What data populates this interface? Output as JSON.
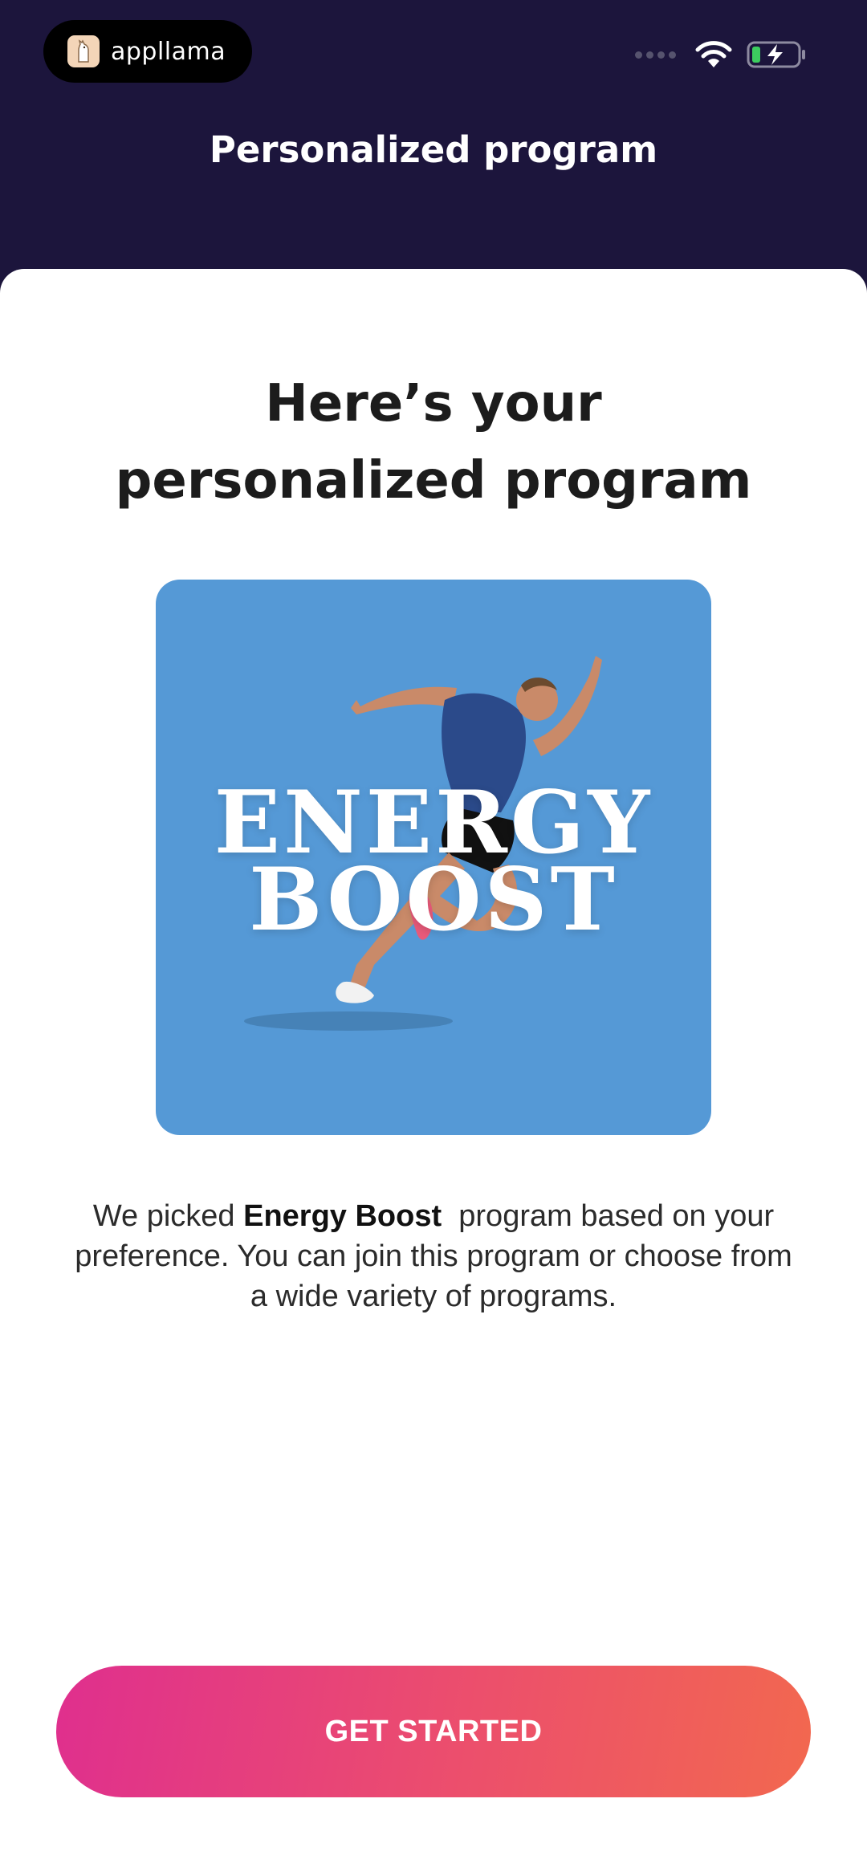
{
  "status_bar": {
    "app_badge_text": "appllama",
    "icons": [
      "llama-logo-icon",
      "signal-dots-icon",
      "wifi-icon",
      "battery-charging-icon"
    ]
  },
  "header": {
    "title": "Personalized program"
  },
  "main": {
    "title_line1": "Here’s your",
    "title_line2": "personalized program",
    "program_art": {
      "line1": "ENERGY",
      "line2": "BOOST"
    },
    "description": {
      "prefix": "We picked ",
      "program_name": "Energy Boost",
      "suffix": "  program based on your preference. You can join this program or choose from a wide variety of programs."
    },
    "cta_label": "GET STARTED"
  },
  "colors": {
    "header_bg": "#1c153c",
    "card_bg": "#ffffff",
    "image_bg": "#5599d6",
    "cta_gradient_start": "#df2f8e",
    "cta_gradient_end": "#f2684f",
    "battery_green": "#3ccd5f"
  }
}
